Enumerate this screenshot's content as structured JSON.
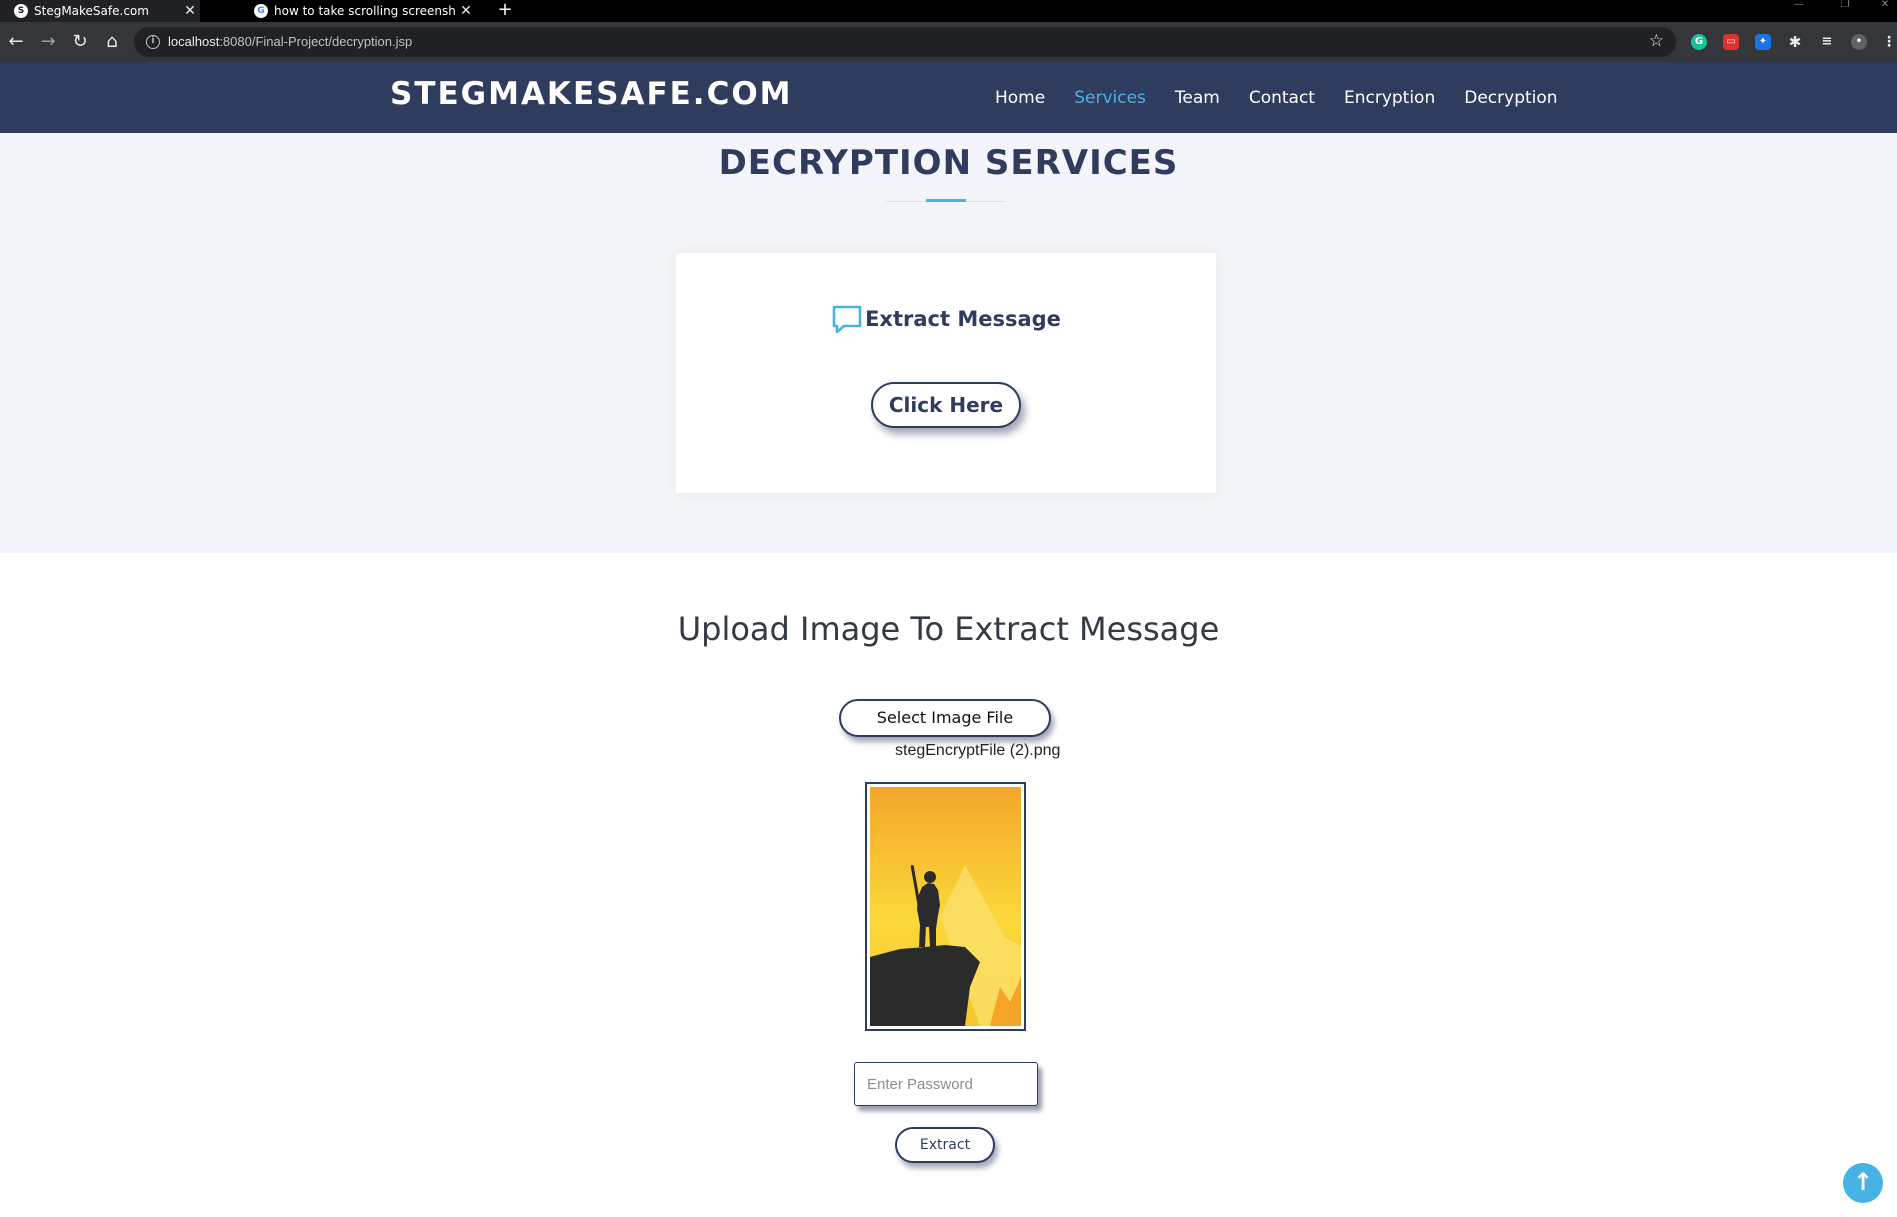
{
  "browser": {
    "tabs": [
      {
        "title": "StegMakeSafe.com",
        "icon": "site-favicon",
        "active": true
      },
      {
        "title": "how to take scrolling screenshot",
        "icon": "google-favicon",
        "active": false
      }
    ],
    "url_host": "localhost",
    "url_rest": ":8080/Final-Project/decryption.jsp",
    "extensions": [
      "grammarly-icon",
      "pdf-extension-icon",
      "extension-blue-icon",
      "puzzle-icon",
      "media-queue-icon",
      "profile-icon"
    ]
  },
  "header": {
    "logo": "STEGMAKESAFE.COM",
    "nav": [
      {
        "label": "Home",
        "current": false
      },
      {
        "label": "Services",
        "current": true
      },
      {
        "label": "Team",
        "current": false
      },
      {
        "label": "Contact",
        "current": false
      },
      {
        "label": "Encryption",
        "current": false
      },
      {
        "label": "Decryption",
        "current": false
      }
    ]
  },
  "services": {
    "title": "DECRYPTION SERVICES",
    "card": {
      "icon": "chat-bubble-icon",
      "label": "Extract Message",
      "button": "Click Here"
    }
  },
  "upload": {
    "title": "Upload Image To Extract Message",
    "select_button": "Select Image File",
    "filename": "stegEncryptFile (2).png",
    "password_placeholder": "Enter Password",
    "extract_button": "Extract"
  },
  "colors": {
    "header_bg": "#2f3c5e",
    "accent": "#47b2e4",
    "section_bg": "#f3f5fa"
  }
}
